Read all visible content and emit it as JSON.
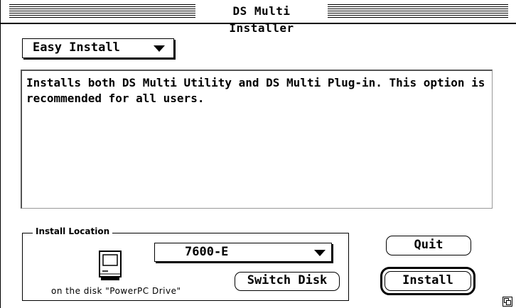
{
  "window": {
    "title": "DS Multi Installer"
  },
  "install_mode": {
    "selected": "Easy Install"
  },
  "description": "Installs both DS Multi Utility and DS Multi Plug-in. This option is recommended for all users.",
  "install_location": {
    "label": "Install Location",
    "selected_disk": "7600-E",
    "disk_caption": "on the disk \"PowerPC Drive\"",
    "switch_disk_label": "Switch Disk"
  },
  "buttons": {
    "quit": "Quit",
    "install": "Install"
  },
  "icons": {
    "disk": "mac-computer-icon",
    "grow": "resize-grow-box-icon"
  }
}
